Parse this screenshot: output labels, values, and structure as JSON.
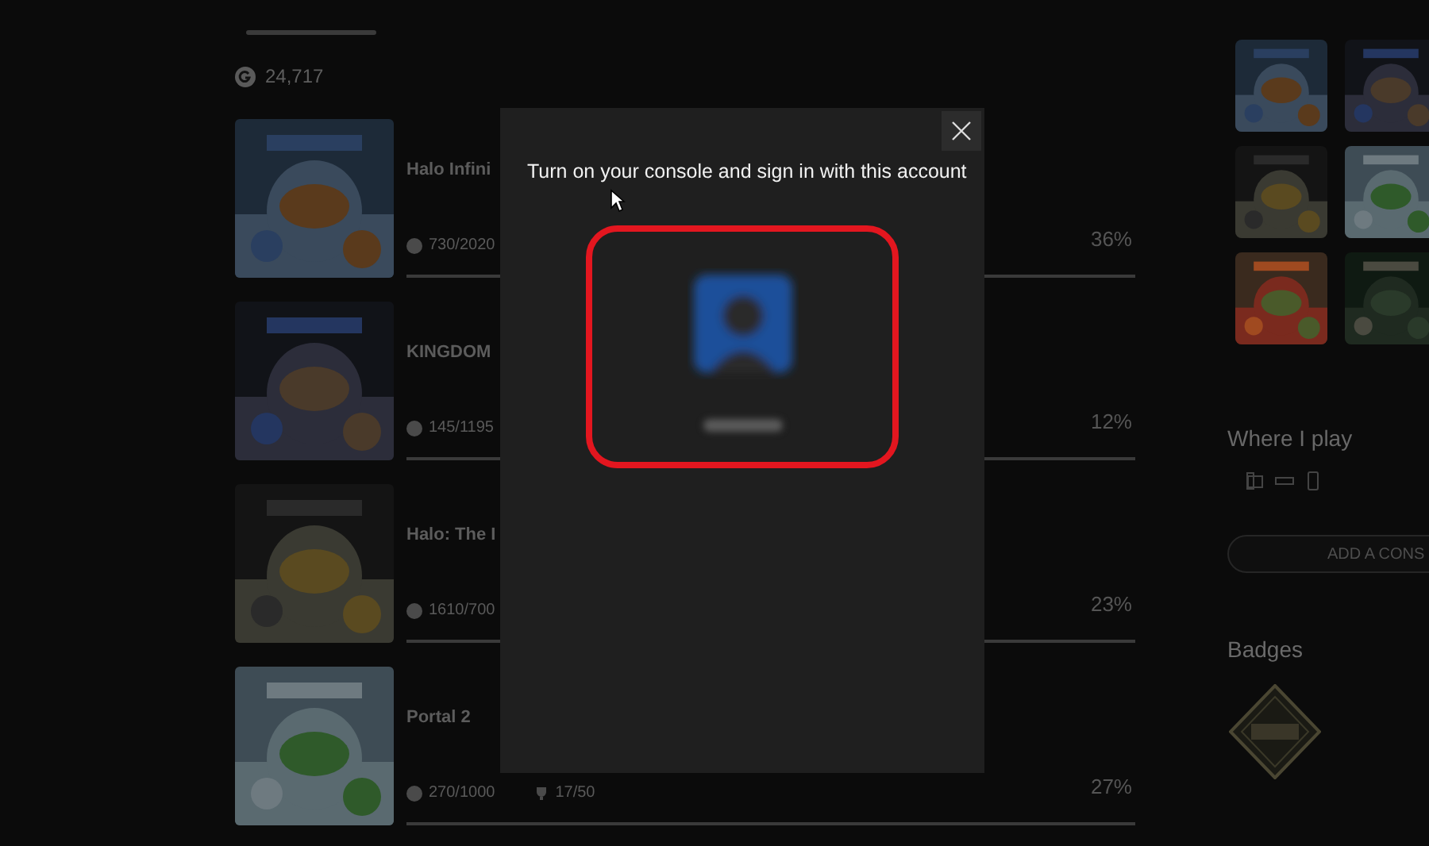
{
  "gamerscore": {
    "value": "24,717"
  },
  "games": [
    {
      "title": "Halo Infini",
      "score": "730/2020",
      "progress": "36%"
    },
    {
      "title": "KINGDOM",
      "score": "145/1195",
      "progress": "12%"
    },
    {
      "title": "Halo: The I",
      "score": "1610/700",
      "progress": "23%"
    },
    {
      "title": "Portal 2",
      "score": "270/1000",
      "achievements": "17/50",
      "progress": "27%"
    }
  ],
  "where_i_play": {
    "title": "Where I play",
    "button": "ADD A CONS"
  },
  "badges": {
    "title": "Badges"
  },
  "dialog": {
    "message": "Turn on your console and sign in with this account"
  }
}
